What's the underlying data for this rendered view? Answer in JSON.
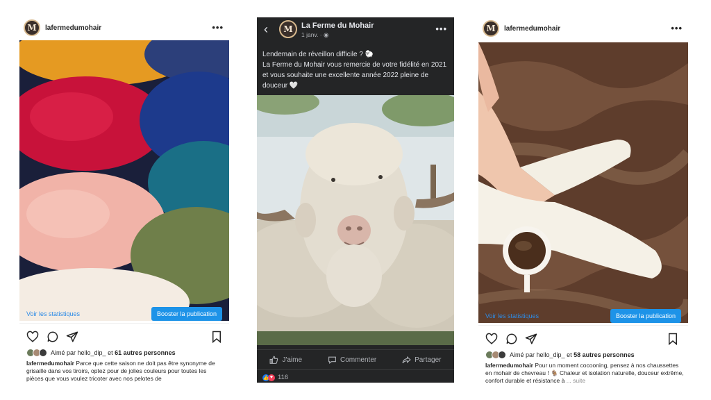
{
  "post_left": {
    "username": "lafermedumohair",
    "more": "•••",
    "stats_link": "Voir les statistiques",
    "boost_button": "Booster la publication",
    "liked_prefix": "Aimé par",
    "liked_user": "hello_dip_",
    "liked_and": "et",
    "liked_others": "61 autres personnes",
    "caption_user": "lafermedumohair",
    "caption_text": "Parce que cette saison ne doit pas être synonyme de grisaille dans vos tiroirs, optez pour de jolies couleurs pour toutes les pièces que vous voulez tricoter avec nos pelotes de"
  },
  "post_middle": {
    "page_name": "La Ferme du Mohair",
    "date": "1 janv. · ",
    "more": "•••",
    "text_line1": "Lendemain de réveillon difficile ? 🐑",
    "text_line2": "La Ferme du Mohair vous remercie de votre fidélité en 2021 et vous souhaite une excellente année 2022 pleine de douceur 🤍",
    "like_label": "J'aime",
    "comment_label": "Commenter",
    "share_label": "Partager",
    "reaction_count": "116"
  },
  "post_right": {
    "username": "lafermedumohair",
    "more": "•••",
    "stats_link": "Voir les statistiques",
    "boost_button": "Booster la publication",
    "liked_prefix": "Aimé par",
    "liked_user": "hello_dip_",
    "liked_and": "et",
    "liked_others": "58 autres personnes",
    "caption_user": "lafermedumohair",
    "caption_text": "Pour un moment cocooning, pensez à nos chaussettes en mohair de chevreau ! 🐐 Chaleur et isolation naturelle, douceur extrême, confort durable et résistance à",
    "caption_more": "... suite"
  },
  "colors": {
    "instagram_link": "#2d8be6",
    "instagram_boost": "#1d93e8",
    "facebook_bg": "#242526",
    "facebook_text": "#e4e6eb"
  },
  "icons": [
    "avatar-logo",
    "more-icon",
    "heart-icon",
    "comment-icon",
    "send-icon",
    "bookmark-icon",
    "back-arrow-icon",
    "globe-icon",
    "like-icon",
    "comment-icon",
    "share-icon"
  ]
}
